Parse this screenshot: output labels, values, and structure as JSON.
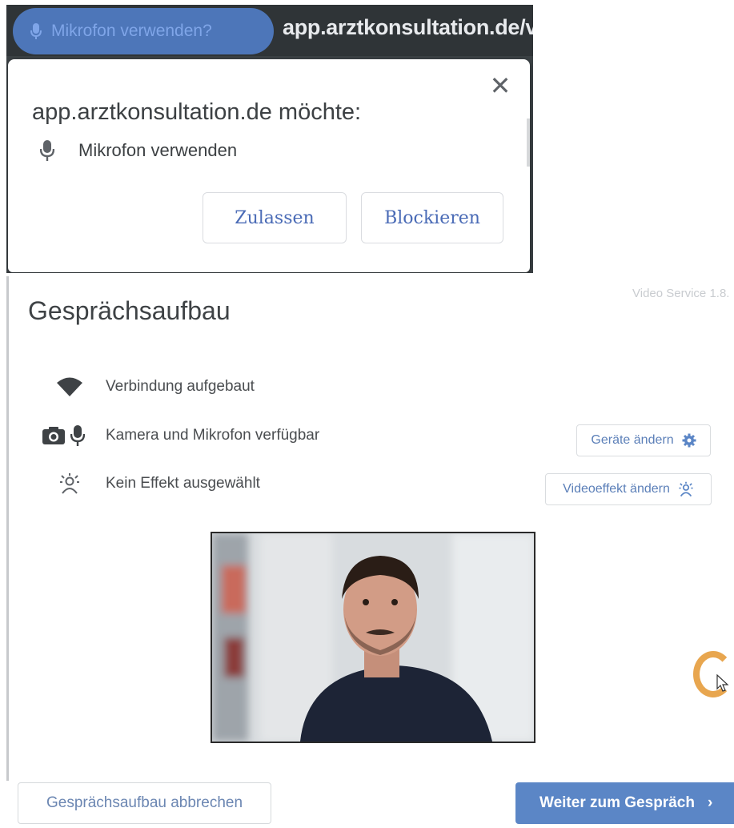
{
  "browser": {
    "chip_label": "Mikrofon verwenden?",
    "url": "app.arztkonsultation.de/v",
    "popup": {
      "title": "app.arztkonsultation.de möchte:",
      "permission_label": "Mikrofon verwenden",
      "allow_label": "Zulassen",
      "block_label": "Blockieren",
      "close_symbol": "✕"
    }
  },
  "page": {
    "version": "Video Service 1.8.",
    "title": "Gesprächsaufbau",
    "status": [
      {
        "icon": "wifi-icon",
        "label": "Verbindung aufgebaut"
      },
      {
        "icon": "camera-icon",
        "label": "Kamera und Mikrofon verfügbar"
      },
      {
        "icon": "video-effect-icon",
        "label": "Kein Effekt ausgewählt"
      }
    ],
    "devices_button": "Geräte ändern",
    "effect_button": "Videoeffekt ändern",
    "cancel_button": "Gesprächsaufbau abbrechen",
    "next_button": "Weiter zum Gespräch",
    "next_chevron": "›"
  },
  "colors": {
    "accent": "#5b86c6",
    "link_text": "#5b7fb8",
    "chip": "#4d76b9",
    "browser_dark": "#3b4144"
  }
}
